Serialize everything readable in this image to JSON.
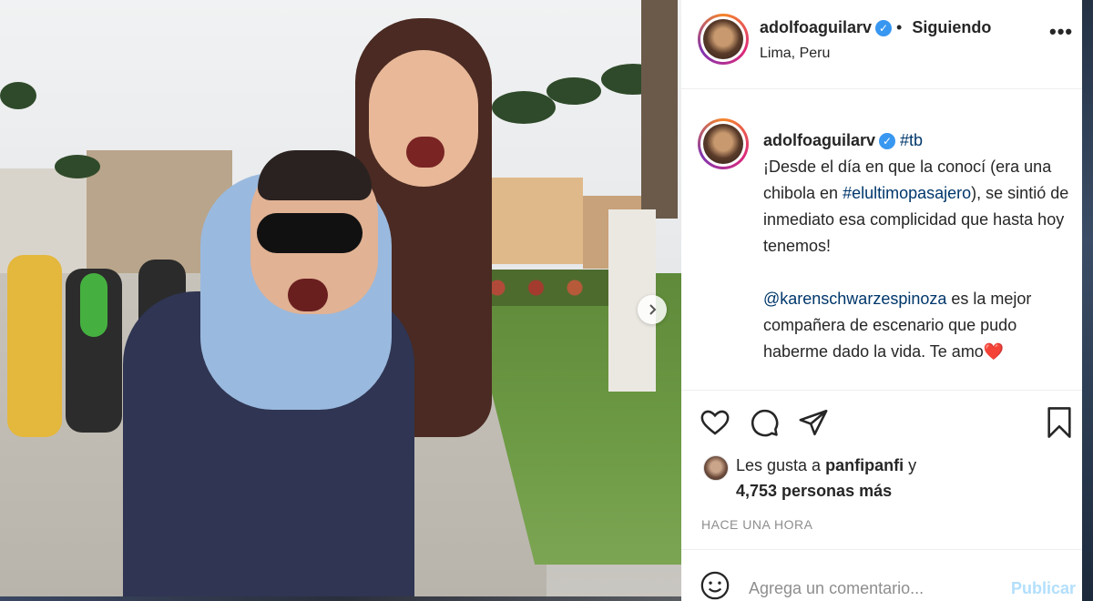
{
  "post": {
    "author": "adolfoaguilarv",
    "follow_status": "Siguiendo",
    "location": "Lima, Peru",
    "caption": {
      "author": "adolfoaguilarv",
      "hashtag": "#tb",
      "text_1": "¡Desde el día en que la conocí (era una chibola en ",
      "hashtag_2": "#elultimopasajero",
      "text_2": "), se sintió de inmediato esa complicidad que hasta hoy tenemos!",
      "mention": "@karenschwarzespinoza",
      "text_3": " es la mejor compañera de escenario que pudo haberme dado la vida. Te amo",
      "emoji": "❤️"
    },
    "likes": {
      "prefix": "Les gusta a ",
      "user": "panfipanfi",
      "suffix": " y",
      "others": "4,753 personas más"
    },
    "time": "HACE UNA HORA",
    "comment_placeholder": "Agrega un comentario...",
    "publish_label": "Publicar",
    "more_label": "•••",
    "separator": " • ",
    "verified_mark": "✓"
  },
  "icons": [
    "heart-icon",
    "comment-icon",
    "share-icon",
    "bookmark-icon",
    "emoji-icon",
    "chevron-right-icon",
    "more-icon",
    "verified-icon"
  ],
  "colors": {
    "link": "#00376b",
    "verified": "#3897f0",
    "publish": "#b2dffc",
    "muted": "#8e8e8e"
  }
}
